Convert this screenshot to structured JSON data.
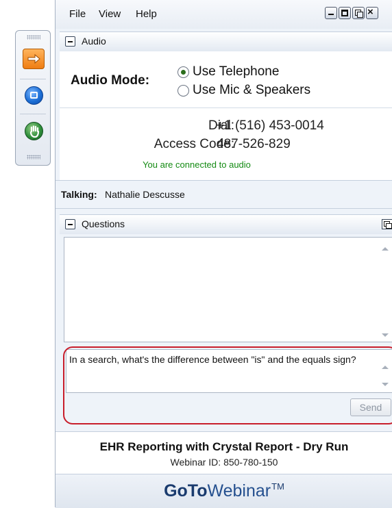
{
  "menu": {
    "file": "File",
    "view": "View",
    "help": "Help"
  },
  "audio": {
    "header": "Audio",
    "mode_label": "Audio Mode:",
    "options": [
      {
        "label": "Use Telephone",
        "selected": true
      },
      {
        "label": "Use Mic & Speakers",
        "selected": false
      }
    ],
    "dial_label": "Dial:",
    "dial_value": "+1 (516) 453-0014",
    "access_code_label": "Access Code:",
    "access_code_value": "487-526-829",
    "status": "You are connected to audio"
  },
  "talking": {
    "label": "Talking:",
    "name": "Nathalie Descusse"
  },
  "questions": {
    "header": "Questions",
    "input_text": "In a search, what's the difference between \"is\" and the equals sign?",
    "send_label": "Send"
  },
  "session": {
    "title": "EHR Reporting with Crystal Report - Dry Run",
    "webinar_id": "Webinar ID: 850-780-150"
  },
  "brand": {
    "part1": "GoTo",
    "part2": "Webinar",
    "tm": "TM"
  },
  "icons": {
    "grabber": [
      "arrow-icon",
      "screen-sharing-icon",
      "raise-hand-icon"
    ],
    "window": [
      "minimize-icon",
      "restore-icon",
      "popout-icon",
      "close-icon"
    ]
  },
  "colors": {
    "status_green": "#138a12",
    "highlight_red": "#c81d2a",
    "accent_orange": "#ef7d12",
    "accent_blue": "#1d6fd6"
  }
}
